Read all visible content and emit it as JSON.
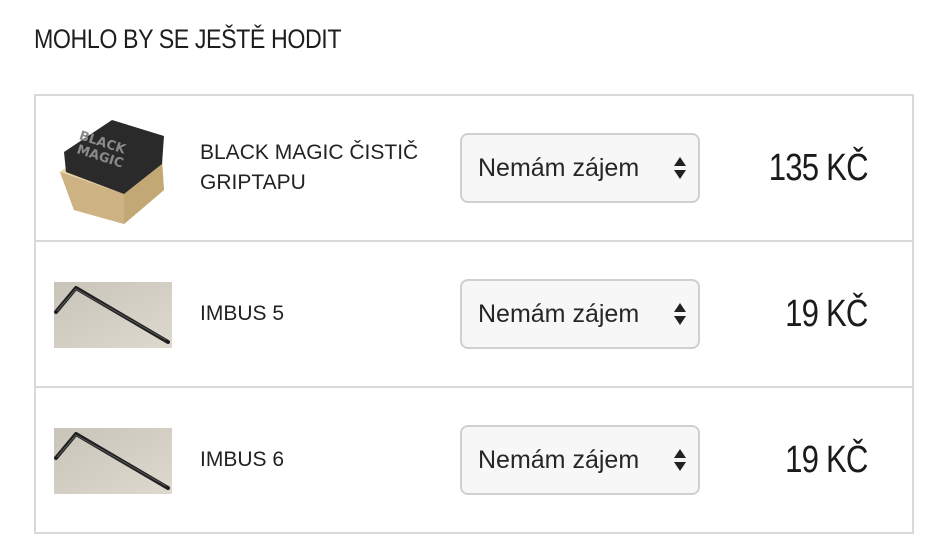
{
  "section": {
    "title": "MOHLO BY SE JEŠTĚ HODIT"
  },
  "products": [
    {
      "name": "BLACK MAGIC ČISTIČ GRIPTAPU",
      "image_label": "BLACK MAGIC",
      "image_icon": "black-magic-eraser",
      "select_value": "Nemám zájem",
      "price": "135 KČ"
    },
    {
      "name": "IMBUS 5",
      "image_icon": "allen-key",
      "select_value": "Nemám zájem",
      "price": "19 KČ"
    },
    {
      "name": "IMBUS 6",
      "image_icon": "allen-key",
      "select_value": "Nemám zájem",
      "price": "19 KČ"
    }
  ],
  "colors": {
    "border": "#d9d9d9",
    "select_bg": "#f7f7f7",
    "text": "#222222"
  }
}
